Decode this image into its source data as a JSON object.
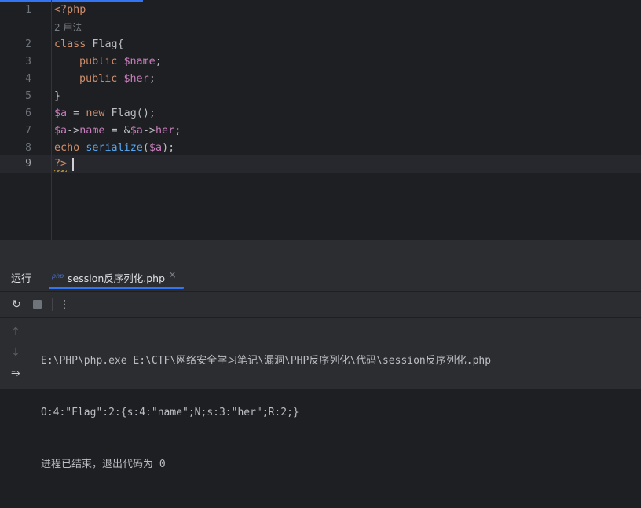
{
  "editor": {
    "line_numbers": [
      "1",
      "2",
      "3",
      "4",
      "5",
      "6",
      "7",
      "8",
      "9"
    ],
    "inlay_hint": "2 用法",
    "lines": {
      "l1": "<?php",
      "l2_kw": "class",
      "l2_rest": " Flag{",
      "l3_kw": "public",
      "l3_var": "$name",
      "l3_end": ";",
      "l4_kw": "public",
      "l4_var": "$her",
      "l4_end": ";",
      "l5": "}",
      "l6_var": "$a",
      "l6_mid": " = ",
      "l6_kw": "new",
      "l6_end": " Flag();",
      "l7_var1": "$a",
      "l7_arrow1": "->",
      "l7_prop1": "name",
      "l7_mid": " = &",
      "l7_var2": "$a",
      "l7_arrow2": "->",
      "l7_prop2": "her",
      "l7_end": ";",
      "l8_kw": "echo",
      "l8_fn": "serialize",
      "l8_open": "(",
      "l8_var": "$a",
      "l8_end": ");",
      "l9": "?>"
    }
  },
  "run_panel": {
    "title": "运行",
    "tab_icon_text": "php",
    "tab_label": "session反序列化.php",
    "tab_close": "×",
    "toolbar": {
      "rerun_icon": "↻",
      "more_icon": "⋮"
    },
    "side_icons": {
      "up": "↑",
      "down": "↓",
      "wrap": "⥱"
    },
    "console_lines": [
      "E:\\PHP\\php.exe E:\\CTF\\网络安全学习笔记\\漏洞\\PHP反序列化\\代码\\session反序列化.php",
      "O:4:\"Flag\":2:{s:4:\"name\";N;s:3:\"her\";R:2;}",
      "进程已结束，退出代码为 0"
    ]
  },
  "colors": {
    "background": "#1e1f22",
    "keyword": "#cf8e6d",
    "variable": "#c77dbb",
    "function": "#56a8f5",
    "accent": "#3574f0"
  }
}
